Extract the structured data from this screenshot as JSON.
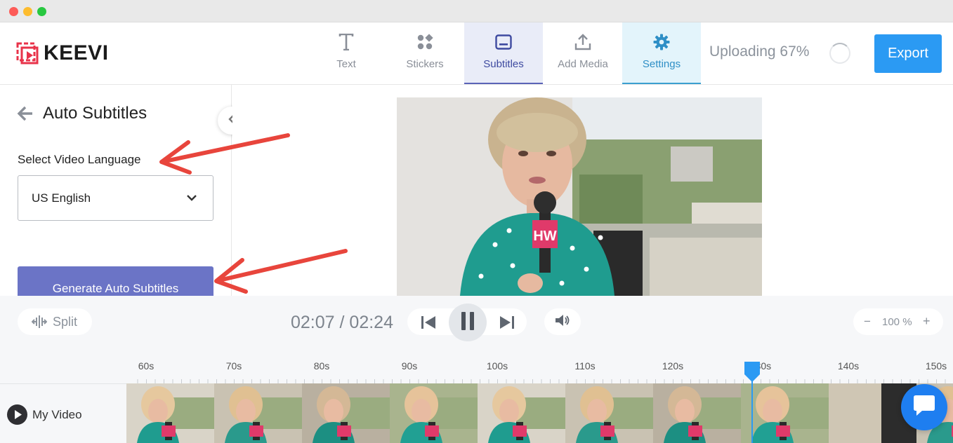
{
  "app": {
    "brand": "KEEVI"
  },
  "nav": {
    "tabs": [
      {
        "label": "Text",
        "icon": "text-icon",
        "state": "normal"
      },
      {
        "label": "Stickers",
        "icon": "stickers-icon",
        "state": "normal"
      },
      {
        "label": "Subtitles",
        "icon": "subtitles-icon",
        "state": "active"
      },
      {
        "label": "Add Media",
        "icon": "upload-icon",
        "state": "normal"
      },
      {
        "label": "Settings",
        "icon": "gear-icon",
        "state": "highlighted"
      }
    ],
    "upload_status": "Uploading 67%",
    "upload_progress": 67,
    "export_label": "Export"
  },
  "sidebar": {
    "title": "Auto Subtitles",
    "language_label": "Select Video Language",
    "language_value": "US English",
    "generate_label": "Generate Auto Subtitles"
  },
  "controls": {
    "split_label": "Split",
    "current_time": "02:07",
    "separator": "/",
    "total_time": "02:24",
    "zoom_minus": "−",
    "zoom_value": "100 %",
    "zoom_plus": "+"
  },
  "timeline": {
    "ticks": [
      "60s",
      "70s",
      "80s",
      "90s",
      "100s",
      "110s",
      "120s",
      "130s",
      "140s",
      "150s"
    ],
    "track_name": "My Video",
    "playhead_time_s": 130
  },
  "colors": {
    "accent": "#2b9af3",
    "subtitles_tab_bg": "#e9ecf8",
    "settings_tab_bg": "#e3f4fb",
    "generate_button": "#6b74c6",
    "annotation_arrow": "#e8453c",
    "logo": "#e8334a"
  }
}
